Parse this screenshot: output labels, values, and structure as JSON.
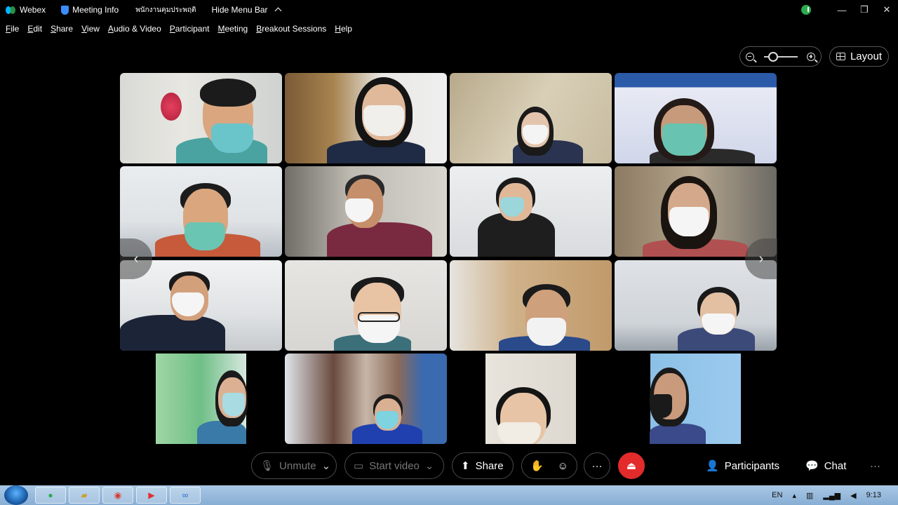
{
  "titlebar": {
    "app": "Webex",
    "meeting_info": "Meeting Info",
    "meeting_name": "พนักงานคุมประพฤติ",
    "hide_menu": "Hide Menu Bar"
  },
  "menu": [
    "File",
    "Edit",
    "Share",
    "View",
    "Audio & Video",
    "Participant",
    "Meeting",
    "Breakout Sessions",
    "Help"
  ],
  "layout_label": "Layout",
  "controls": {
    "unmute": "Unmute",
    "start_video": "Start video",
    "share": "Share",
    "more": "···",
    "participants": "Participants",
    "chat": "Chat",
    "overflow": "···"
  },
  "taskbar": {
    "lang": "EN",
    "time": "9:13"
  },
  "colors": {
    "accent_red": "#e32b2b",
    "status_green": "#2eaa4f",
    "background": "#000000"
  }
}
